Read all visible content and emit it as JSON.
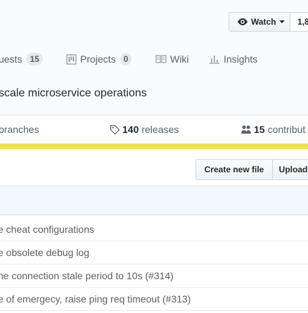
{
  "header": {
    "watch_label": "Watch",
    "watch_count": "1,8"
  },
  "tabs": [
    {
      "label": "uests",
      "count": "15"
    },
    {
      "label": "Projects",
      "count": "0"
    },
    {
      "label": "Wiki"
    },
    {
      "label": "Insights"
    }
  ],
  "repo": {
    "description": "scale microservice operations"
  },
  "summary": {
    "branches_label": "branches",
    "releases_count": "140",
    "releases_label": "releases",
    "contributors_count": "15",
    "contributors_label": "contribut"
  },
  "colors": {
    "language_bar": "#f1e05a",
    "background_header": "#fafbfc"
  },
  "actions": {
    "create_new_file": "Create new file",
    "upload": "Upload"
  },
  "commit_messages": [
    "e cheat configurations",
    "e obsolete debug log",
    "he connection stale period to 10s (#314)",
    "e of emergecy, raise ping req timeout (#313)"
  ]
}
